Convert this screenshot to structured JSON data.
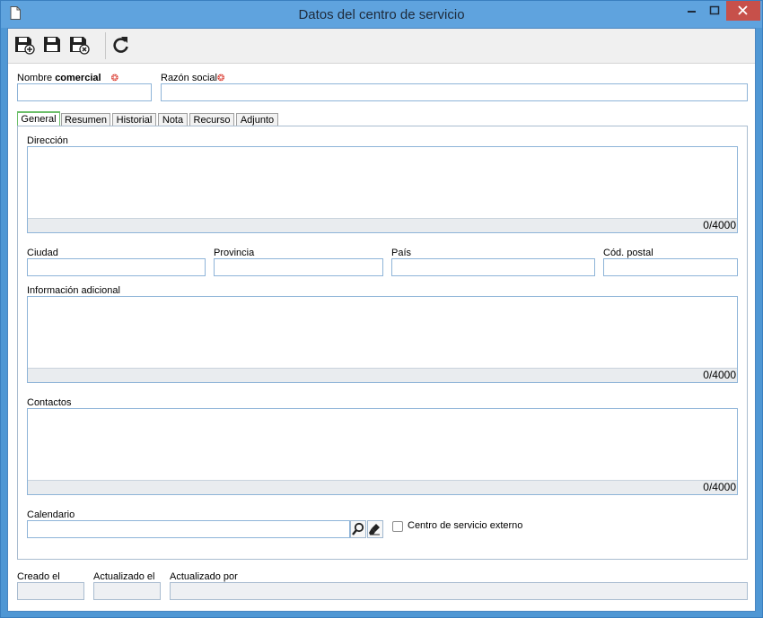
{
  "window": {
    "title": "Datos del centro de servicio",
    "title_icon": "document-icon",
    "controls": [
      "minimize",
      "maximize",
      "close"
    ]
  },
  "toolbar": {
    "buttons": [
      {
        "name": "save-new-button",
        "icon": "save-plus-icon"
      },
      {
        "name": "save-button",
        "icon": "save-icon"
      },
      {
        "name": "save-close-button",
        "icon": "save-close-icon"
      },
      {
        "name": "refresh-button",
        "icon": "refresh-icon"
      }
    ]
  },
  "form": {
    "nombre_comercial": {
      "label_plain": "Nombre ",
      "label_bold": "comercial",
      "required": true,
      "value": ""
    },
    "razon_social": {
      "label": "Razón social",
      "required": true,
      "value": ""
    }
  },
  "tabs": [
    "General",
    "Resumen",
    "Historial",
    "Nota",
    "Recurso",
    "Adjunto"
  ],
  "general": {
    "direccion": {
      "label": "Dirección",
      "value": "",
      "counter": "0/4000"
    },
    "ciudad": {
      "label": "Ciudad",
      "value": ""
    },
    "provincia": {
      "label": "Provincia",
      "value": ""
    },
    "pais": {
      "label": "País",
      "value": ""
    },
    "cod_postal": {
      "label": "Cód. postal",
      "value": ""
    },
    "informacion_adicional": {
      "label": "Información adicional",
      "value": "",
      "counter": "0/4000"
    },
    "contactos": {
      "label": "Contactos",
      "value": "",
      "counter": "0/4000"
    },
    "calendario": {
      "label": "Calendario",
      "value": ""
    },
    "centro_externo": {
      "label": "Centro de servicio externo",
      "checked": false
    }
  },
  "footer": {
    "creado_el": {
      "label": "Creado el",
      "value": ""
    },
    "actualizado_el": {
      "label": "Actualizado el",
      "value": ""
    },
    "actualizado_por": {
      "label": "Actualizado por",
      "value": ""
    }
  },
  "colors": {
    "accent": "#6cbf6a",
    "required": "#d9362b",
    "input_border": "#8eb4d8",
    "close_button": "#c7504a"
  }
}
